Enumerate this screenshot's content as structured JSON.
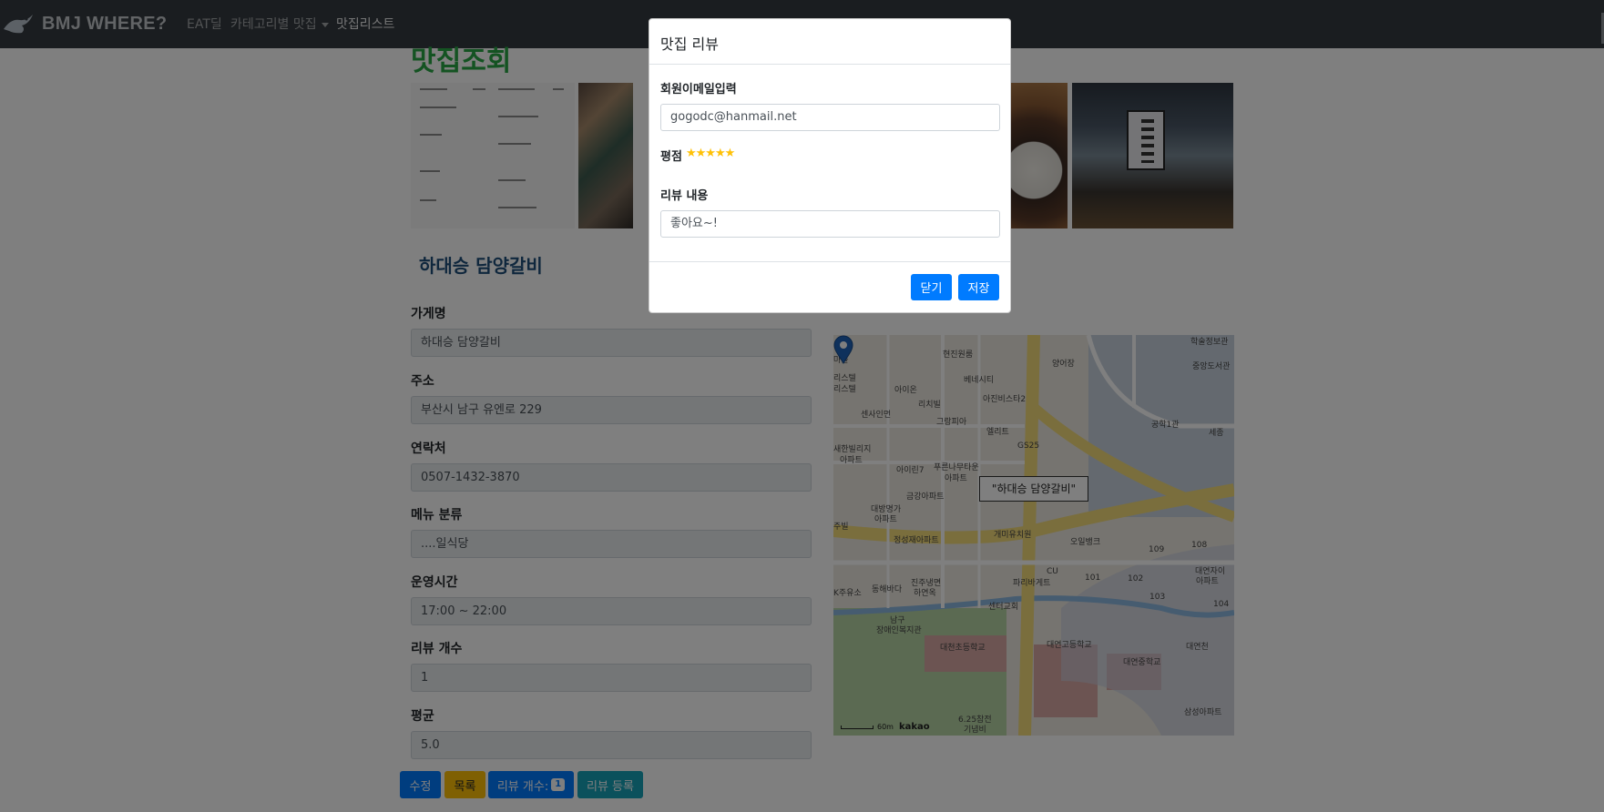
{
  "navbar": {
    "brand": "BMJ WHERE?",
    "links": [
      "EAT딜",
      "카테고리별 맛집",
      "맛집리스트"
    ]
  },
  "page": {
    "title": "맛집조회",
    "shop_name": "하대승 담양갈비"
  },
  "form": {
    "fields": [
      {
        "label": "가게명",
        "value": "하대승 담양갈비"
      },
      {
        "label": "주소",
        "value": "부산시 남구 유엔로 229"
      },
      {
        "label": "연락처",
        "value": "0507-1432-3870"
      },
      {
        "label": "메뉴 분류",
        "value": "....일식당"
      },
      {
        "label": "운영시간",
        "value": "17:00 ~ 22:00"
      },
      {
        "label": "리뷰 개수",
        "value": "1"
      },
      {
        "label": "평균",
        "value": "5.0"
      }
    ]
  },
  "buttons": {
    "edit": "수정",
    "list": "목록",
    "review_count_label": "리뷰 개수:",
    "review_count": "1",
    "add_review": "리뷰 등록"
  },
  "map": {
    "info": "\"하대승 담양갈비\"",
    "scale": "60m",
    "provider": "kakao",
    "labels": [
      "아파트",
      "현진원룸",
      "학술정보관",
      "마을",
      "양어장",
      "중앙도서관",
      "리스텔",
      "아이온",
      "베네시티",
      "리스텔",
      "리치빌",
      "아진비스타2",
      "센사인먼",
      "그랑피아",
      "공학1관",
      "엘리트",
      "GS25",
      "세종",
      "새한빌리지",
      "아이린7",
      "푸른나무타운",
      "아파트",
      "아파트",
      "금강아파트",
      "대방명가",
      "아파트",
      "주빌",
      "정성재아파트",
      "개미유치원",
      "오일뱅크",
      "109",
      "108",
      "CU",
      "101",
      "102",
      "대연자이",
      "아파트",
      "103",
      "104",
      "K주유소",
      "동해바다",
      "진주냉면",
      "하연옥",
      "파리바게트",
      "센터교회",
      "남구",
      "장애인복지관",
      "대연고등학교",
      "대천초등학교",
      "대연중학교",
      "대연천",
      "6.25참전",
      "기념비",
      "삼성아파트"
    ]
  },
  "modal": {
    "title": "맛집 리뷰",
    "email_label": "회원이메일입력",
    "email_value": "gogodc@hanmail.net",
    "rating_label": "평점",
    "rating_stars": "★★★★★",
    "content_label": "리뷰 내용",
    "content_value": "좋아요~!",
    "close": "닫기",
    "save": "저장"
  },
  "colors": {
    "navbar": "#343a40",
    "title_green": "#28a745",
    "primary": "#007bff",
    "warning": "#ffc107",
    "info": "#17a2b8"
  }
}
